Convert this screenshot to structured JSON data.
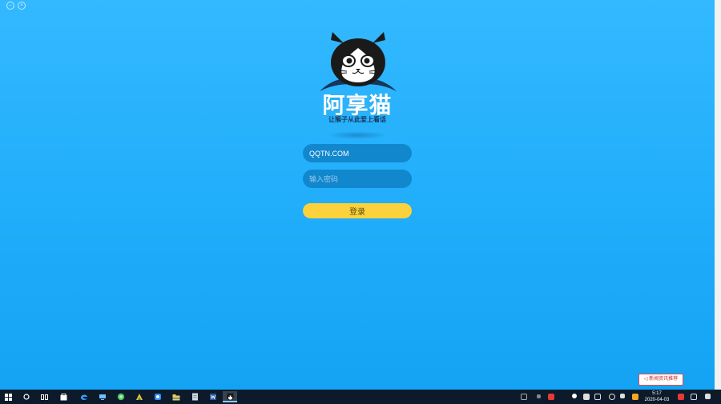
{
  "login": {
    "brand_name": "阿享猫",
    "slogan": "让猴子从此爱上看话",
    "account_value": "QQTN.COM",
    "password_placeholder": "输入密码",
    "login_label": "登录"
  },
  "taskbar": {
    "active_app": "阿享猫",
    "clock_time": "5:17",
    "clock_date": "2020-04-03"
  },
  "notice": {
    "label": "◁ 新闻资讯推荐"
  },
  "colors": {
    "background": "#29b3ff",
    "field": "#1187cd",
    "login_button": "#fbd13c",
    "taskbar": "#0c1a2a"
  }
}
